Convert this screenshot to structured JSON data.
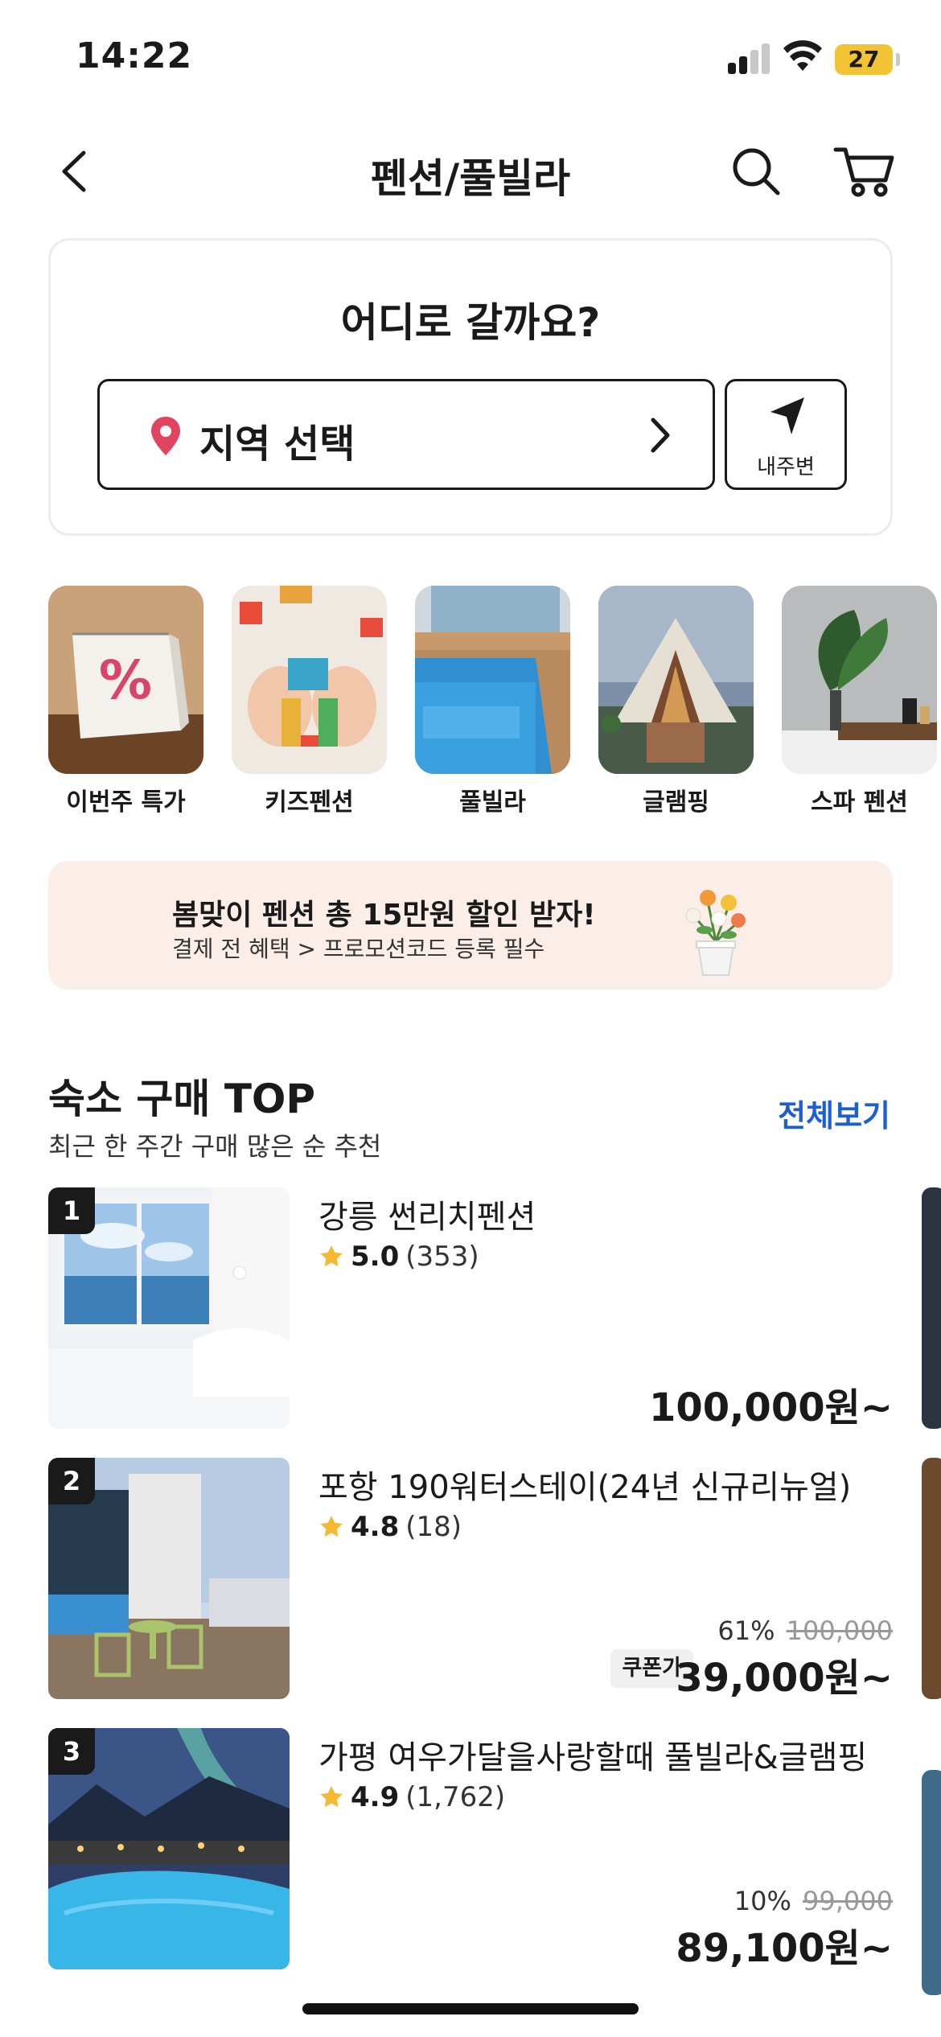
{
  "status_bar": {
    "time": "14:22",
    "battery": "27"
  },
  "header": {
    "title": "펜션/풀빌라"
  },
  "location_card": {
    "title": "어디로 갈까요?",
    "region_label": "지역 선택",
    "nearby_label": "내주변"
  },
  "categories": [
    {
      "label": "이번주 특가",
      "thumb_icon": "calendar-percent"
    },
    {
      "label": "키즈펜션",
      "thumb_icon": "toy-blocks"
    },
    {
      "label": "풀빌라",
      "thumb_icon": "pool"
    },
    {
      "label": "글램핑",
      "thumb_icon": "tent"
    },
    {
      "label": "스파 펜션",
      "thumb_icon": "spa-bath"
    }
  ],
  "banner": {
    "title": "봄맞이 펜션 총 15만원 할인 받자!",
    "subtitle": "결제 전 혜택 > 프로모션코드 등록 필수"
  },
  "top_section": {
    "title": "숙소 구매 TOP",
    "subtitle": "최근 한 주간 구매 많은 순 추천",
    "view_all": "전체보기",
    "items": [
      {
        "rank": "1",
        "name": "강릉 썬리치펜션",
        "score": "5.0",
        "count": "(353)",
        "discount": "",
        "original": "",
        "coupon": "",
        "price": "100,000원~"
      },
      {
        "rank": "2",
        "name": "포항 190워터스테이(24년 신규리뉴얼)",
        "score": "4.8",
        "count": "(18)",
        "discount": "61%",
        "original": "100,000",
        "coupon": "쿠폰가",
        "price": "39,000원~"
      },
      {
        "rank": "3",
        "name": "가평 여우가달을사랑할때 풀빌라&글램핑",
        "score": "4.9",
        "count": "(1,762)",
        "discount": "10%",
        "original": "99,000",
        "coupon": "",
        "price": "89,100원~"
      }
    ]
  },
  "colors": {
    "accent_blue": "#1d5fd1",
    "pin": "#e0445e",
    "star": "#f5b82e",
    "banner_bg": "#fbeee9",
    "battery": "#f2c335"
  }
}
